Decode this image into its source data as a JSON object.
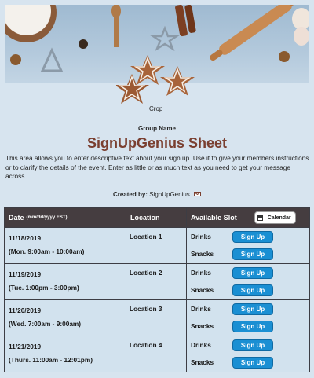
{
  "banner": {
    "crop_label": "Crop"
  },
  "group_name": "Group Name",
  "title": "SignUpGenius Sheet",
  "description": "This area allows you to enter descriptive text about your sign up. Use it to give your members instructions or to clarify the details of the event. Enter as little or as much text as you need to get your message across.",
  "created_by": {
    "label": "Created by:",
    "name": "SignUpGenius"
  },
  "table": {
    "headers": {
      "date": "Date",
      "date_format": "(mm/dd/yyyy EST)",
      "location": "Location",
      "slot": "Available Slot"
    },
    "calendar_label": "Calendar",
    "signup_label": "Sign Up",
    "rows": [
      {
        "date": "11/18/2019",
        "time": "(Mon. 9:00am - 10:00am)",
        "location": "Location 1",
        "slots": [
          "Drinks",
          "Snacks"
        ]
      },
      {
        "date": "11/19/2019",
        "time": "(Tue. 1:00pm - 3:00pm)",
        "location": "Location 2",
        "slots": [
          "Drinks",
          "Snacks"
        ]
      },
      {
        "date": "11/20/2019",
        "time": "(Wed. 7:00am - 9:00am)",
        "location": "Location 3",
        "slots": [
          "Drinks",
          "Snacks"
        ]
      },
      {
        "date": "11/21/2019",
        "time": "(Thurs. 11:00am - 12:01pm)",
        "location": "Location 4",
        "slots": [
          "Drinks",
          "Snacks"
        ]
      }
    ]
  },
  "colors": {
    "title": "#7a3f30",
    "header_bg": "#453d40",
    "button": "#1a8fd3",
    "page_bg": "#d7e4ef"
  }
}
